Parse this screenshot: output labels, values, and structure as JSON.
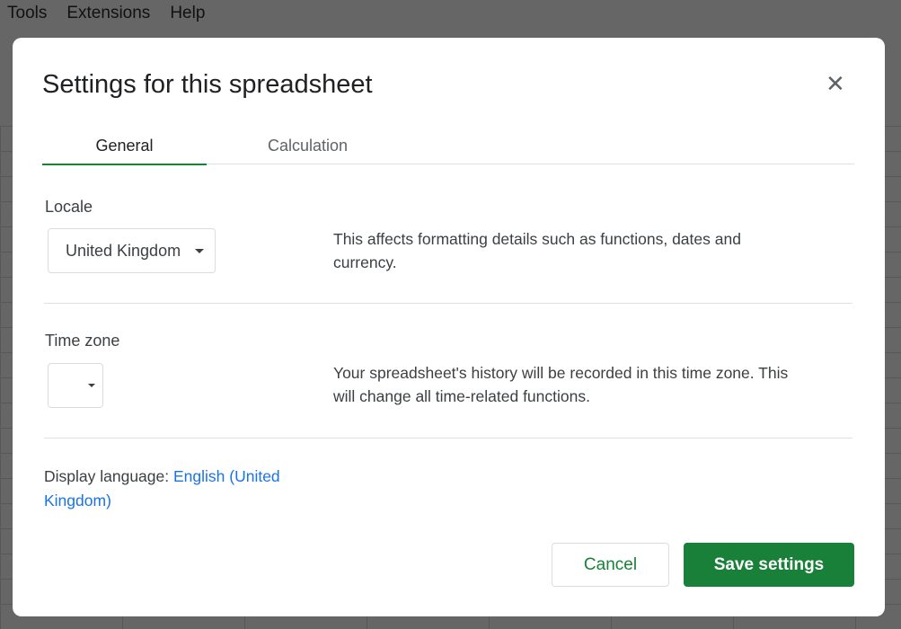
{
  "menubar": {
    "items": [
      "Tools",
      "Extensions",
      "Help"
    ]
  },
  "dialog": {
    "title": "Settings for this spreadsheet",
    "tabs": [
      {
        "label": "General",
        "active": true
      },
      {
        "label": "Calculation",
        "active": false
      }
    ],
    "locale": {
      "label": "Locale",
      "value": "United Kingdom",
      "description": "This affects formatting details such as functions, dates and currency."
    },
    "timezone": {
      "label": "Time zone",
      "value": "",
      "description": "Your spreadsheet's history will be recorded in this time zone. This will change all time-related functions."
    },
    "display_language": {
      "label": "Display language: ",
      "value": "English (United Kingdom)"
    },
    "cancel_label": "Cancel",
    "save_label": "Save settings",
    "accent_color": "#188038"
  }
}
